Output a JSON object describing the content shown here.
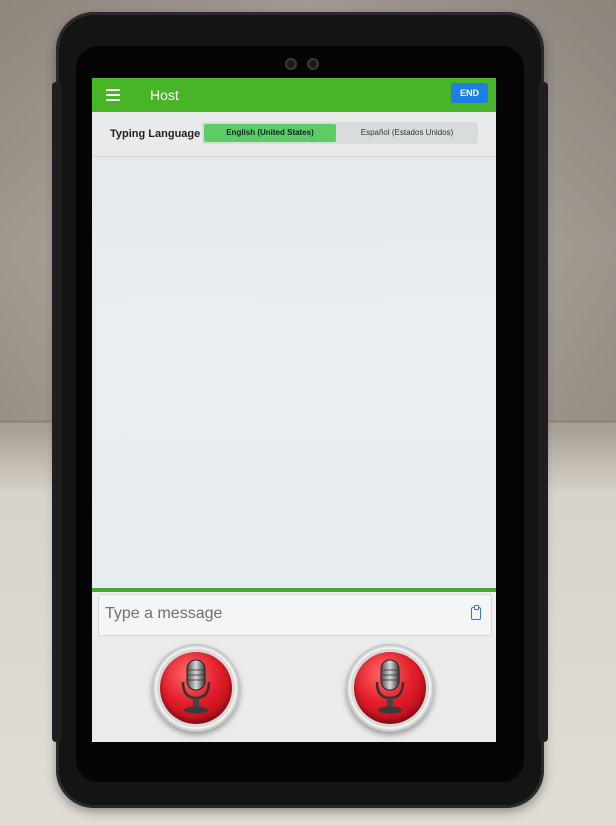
{
  "app_bar": {
    "title": "Host",
    "end_label": "END",
    "color": "#48b529"
  },
  "language_bar": {
    "label": "Typing Language",
    "options": [
      "English (United States)",
      "Español (Estados Unidos)"
    ],
    "selected_index": 0
  },
  "composer": {
    "placeholder": "Type a message",
    "value": "",
    "attach_icon": "clipboard-icon"
  },
  "mic_buttons": [
    {
      "icon": "microphone-icon"
    },
    {
      "icon": "microphone-icon"
    }
  ],
  "colors": {
    "accent": "#48b529",
    "end_button": "#1f7de6",
    "mic": "#e21e2a",
    "selected_language": "#5ccc64"
  }
}
